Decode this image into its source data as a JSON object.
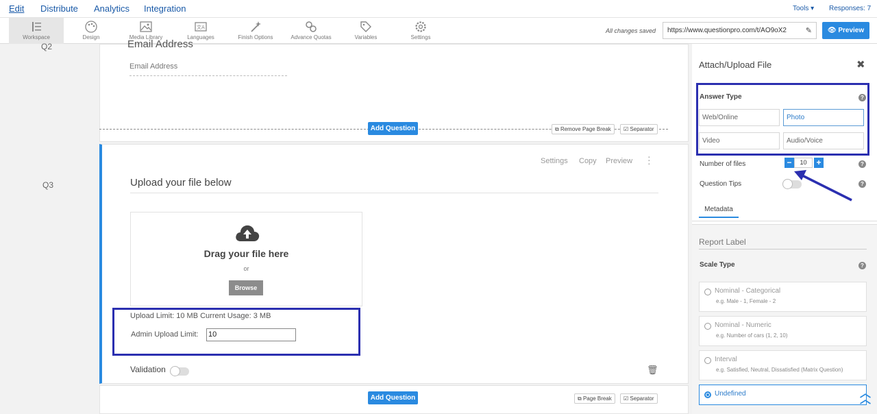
{
  "nav": {
    "tabs": [
      "Edit",
      "Distribute",
      "Analytics",
      "Integration"
    ],
    "tools": "Tools ▾",
    "responses": "Responses: 7"
  },
  "toolbar": {
    "items": [
      "Workspace",
      "Design",
      "Media Library",
      "Languages",
      "Finish Options",
      "Advance Quotas",
      "Variables",
      "Settings"
    ],
    "saved_note": "All changes saved",
    "survey_url": "https://www.questionpro.com/t/AO9oX2",
    "preview_label": "Preview"
  },
  "gutter": {
    "q2": "Q2",
    "q3": "Q3"
  },
  "q2": {
    "title": "Email Address",
    "field_placeholder": "Email Address",
    "add_question": "Add Question",
    "remove_page_break": "Remove Page Break",
    "separator": "Separator"
  },
  "q3": {
    "actions": [
      "Settings",
      "Copy",
      "Preview"
    ],
    "title": "Upload your file below",
    "drop_title": "Drag your file here",
    "drop_or": "or",
    "browse": "Browse",
    "upload_limit_text": "Upload Limit: 10 MB Current Usage: 3 MB",
    "admin_limit_label": "Admin Upload Limit:",
    "admin_limit_value": "10",
    "validation_label": "Validation"
  },
  "bottom": {
    "add_question": "Add Question",
    "page_break": "Page Break",
    "separator": "Separator"
  },
  "panel": {
    "title": "Attach/Upload File",
    "answer_type_label": "Answer Type",
    "answer_types": [
      "Web/Online",
      "Photo",
      "Video",
      "Audio/Voice"
    ],
    "selected_answer_type": "Photo",
    "number_of_files_label": "Number of files",
    "number_of_files_value": "10",
    "question_tips_label": "Question Tips",
    "tab_metadata": "Metadata",
    "report_label": "Report Label",
    "scale_type_label": "Scale Type",
    "scale_types": [
      {
        "name": "Nominal - Categorical",
        "desc": "e.g. Male - 1, Female - 2"
      },
      {
        "name": "Nominal - Numeric",
        "desc": "e.g. Number of cars (1, 2, 10)"
      },
      {
        "name": "Interval",
        "desc": "e.g. Satisfied, Neutral, Dissatisfied (Matrix Question)"
      },
      {
        "name": "Undefined",
        "desc": ""
      }
    ],
    "selected_scale_type": "Undefined"
  },
  "colors": {
    "accent": "#2a8ae0",
    "highlight_box": "#2b2fb0",
    "link": "#1a5aa8"
  }
}
